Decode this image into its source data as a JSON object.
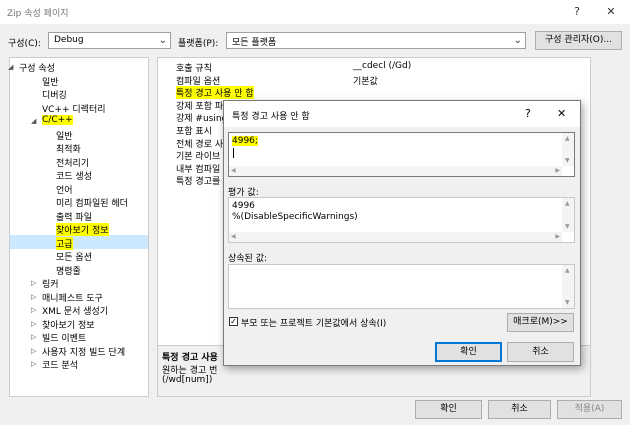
{
  "window": {
    "title": "Zip 속성 페이지",
    "help": "?",
    "close": "✕"
  },
  "toolbar": {
    "config_label": "구성(C):",
    "config_value": "Debug",
    "platform_label": "플랫폼(P):",
    "platform_value": "모든 플랫폼",
    "config_manager_label": "구성 관리자(O)..."
  },
  "tree": {
    "items": [
      "구성 속성",
      "일반",
      "디버깅",
      "VC++ 디렉터리",
      "C/C++",
      "일반",
      "최적화",
      "전처리기",
      "코드 생성",
      "언어",
      "미리 컴파일된 헤더",
      "출력 파일",
      "찾아보기 정보",
      "고급",
      "모든 옵션",
      "명령줄",
      "링커",
      "매니페스트 도구",
      "XML 문서 생성기",
      "찾아보기 정보",
      "빌드 이벤트",
      "사용자 지정 빌드 단계",
      "코드 분석"
    ],
    "expanded_arrow": "◢",
    "collapsed_arrow": "▷"
  },
  "grid": {
    "names": [
      "호출 규칙",
      "컴파일 옵션",
      "특정 경고 사용 안 함",
      "강제 포함 파",
      "강제 #using",
      "포함 표시",
      "전체 경로 사",
      "기본 라이브",
      "내부 컴파일",
      "특정 경고를"
    ],
    "values": [
      "__cdecl (/Gd)",
      "기본값"
    ]
  },
  "description": {
    "title": "특정 경고 사용",
    "line1": "원하는 경고 번",
    "line2": "(/wd[num])"
  },
  "dialog": {
    "title": "특정 경고 사용 안 함",
    "help": "?",
    "close": "✕",
    "input_value": "4996;",
    "evaluated_label": "평가 값:",
    "evaluated_lines": [
      "4996",
      "%(DisableSpecificWarnings)"
    ],
    "inherited_label": "상속된 값:",
    "inherit_checkbox_label": "부모 또는 프로젝트 기본값에서 상속(I)",
    "macro_button": "매크로(M)>>",
    "ok_button": "확인",
    "cancel_button": "취소"
  },
  "footer": {
    "ok": "확인",
    "cancel": "취소",
    "apply": "적용(A)"
  },
  "colors": {
    "highlight": "#ffff00",
    "selection": "#cce8ff",
    "accent": "#0078d7"
  }
}
